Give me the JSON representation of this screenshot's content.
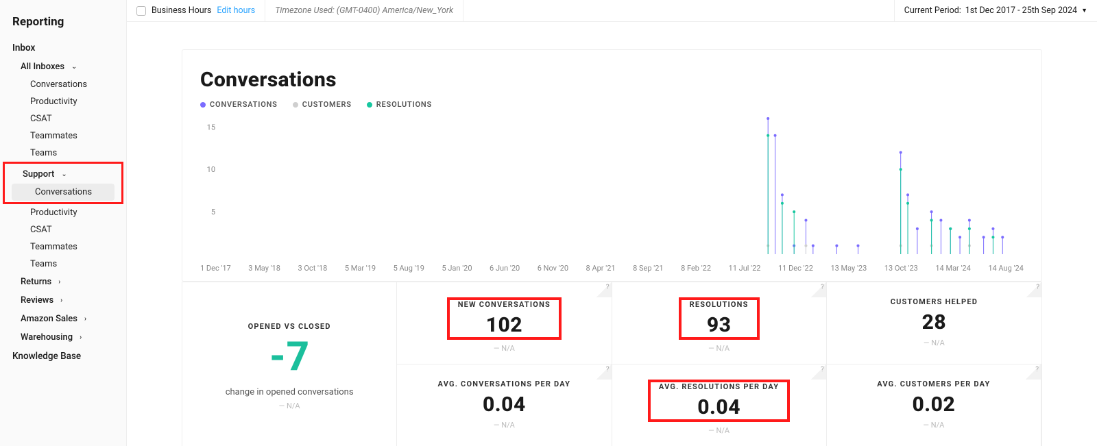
{
  "sidebar": {
    "title": "Reporting",
    "inbox": "Inbox",
    "allInboxes": "All Inboxes",
    "items1": [
      "Conversations",
      "Productivity",
      "CSAT",
      "Teammates",
      "Teams"
    ],
    "support": "Support",
    "items2": [
      "Conversations",
      "Productivity",
      "CSAT",
      "Teammates",
      "Teams"
    ],
    "others": [
      "Returns",
      "Reviews",
      "Amazon Sales",
      "Warehousing"
    ],
    "kb": "Knowledge Base"
  },
  "topbar": {
    "bh": "Business Hours",
    "edit": "Edit hours",
    "tz": "Timezone Used: (GMT-0400) America/New_York",
    "periodLabel": "Current Period:",
    "periodValue": "1st Dec 2017 - 25th Sep 2024"
  },
  "chart": {
    "title": "Conversations",
    "legend": [
      {
        "name": "CONVERSATIONS",
        "color": "#7b6cff"
      },
      {
        "name": "CUSTOMERS",
        "color": "#cfcfcf"
      },
      {
        "name": "RESOLUTIONS",
        "color": "#17c7a0"
      }
    ],
    "yticks": [
      5,
      10,
      15
    ]
  },
  "chart_data": {
    "type": "line",
    "title": "Conversations",
    "xlabel": "",
    "ylabel": "",
    "ylim": [
      0,
      16
    ],
    "categories": [
      "1 Dec '17",
      "3 May '18",
      "3 Oct '18",
      "5 Mar '19",
      "5 Aug '19",
      "5 Jan '20",
      "6 Jun '20",
      "6 Nov '20",
      "8 Apr '21",
      "8 Sep '21",
      "8 Feb '22",
      "11 Jul '22",
      "11 Dec '22",
      "13 May '23",
      "13 Oct '23",
      "14 Mar '24",
      "14 Aug '24"
    ],
    "series": [
      {
        "name": "CONVERSATIONS",
        "color": "#7b6cff",
        "points": [
          {
            "x": 11.55,
            "y": 16
          },
          {
            "x": 11.7,
            "y": 14
          },
          {
            "x": 11.85,
            "y": 7
          },
          {
            "x": 12.35,
            "y": 4
          },
          {
            "x": 12.1,
            "y": 1
          },
          {
            "x": 12.5,
            "y": 1
          },
          {
            "x": 13.0,
            "y": 1
          },
          {
            "x": 13.45,
            "y": 1
          },
          {
            "x": 14.35,
            "y": 12
          },
          {
            "x": 14.5,
            "y": 7
          },
          {
            "x": 14.7,
            "y": 3
          },
          {
            "x": 15.0,
            "y": 5
          },
          {
            "x": 15.2,
            "y": 4
          },
          {
            "x": 15.4,
            "y": 3
          },
          {
            "x": 15.6,
            "y": 2
          },
          {
            "x": 15.8,
            "y": 4
          },
          {
            "x": 16.1,
            "y": 2
          },
          {
            "x": 16.3,
            "y": 3
          },
          {
            "x": 16.5,
            "y": 2
          }
        ]
      },
      {
        "name": "CUSTOMERS",
        "color": "#cfcfcf",
        "points": [
          {
            "x": 11.55,
            "y": 1
          },
          {
            "x": 12.35,
            "y": 1
          },
          {
            "x": 14.35,
            "y": 1
          },
          {
            "x": 15.0,
            "y": 1
          },
          {
            "x": 15.8,
            "y": 1
          }
        ]
      },
      {
        "name": "RESOLUTIONS",
        "color": "#17c7a0",
        "points": [
          {
            "x": 11.55,
            "y": 14
          },
          {
            "x": 11.85,
            "y": 6
          },
          {
            "x": 12.1,
            "y": 5
          },
          {
            "x": 14.35,
            "y": 10
          },
          {
            "x": 14.5,
            "y": 6
          },
          {
            "x": 15.0,
            "y": 4
          },
          {
            "x": 15.4,
            "y": 3
          },
          {
            "x": 15.8,
            "y": 3
          },
          {
            "x": 16.3,
            "y": 2
          }
        ]
      }
    ]
  },
  "xlabels": [
    "1 Dec '17",
    "3 May '18",
    "3 Oct '18",
    "5 Mar '19",
    "5 Aug '19",
    "5 Jan '20",
    "6 Jun '20",
    "6 Nov '20",
    "8 Apr '21",
    "8 Sep '21",
    "8 Feb '22",
    "11 Jul '22",
    "11 Dec '22",
    "13 May '23",
    "13 Oct '23",
    "14 Mar '24",
    "14 Aug '24"
  ],
  "metrics": {
    "big": {
      "label": "OPENED VS CLOSED",
      "value": "-7",
      "sub": "change in opened conversations",
      "na": "N/A"
    },
    "r1": [
      {
        "label": "NEW CONVERSATIONS",
        "value": "102",
        "na": "N/A",
        "anno": true
      },
      {
        "label": "RESOLUTIONS",
        "value": "93",
        "na": "N/A",
        "anno": true
      },
      {
        "label": "CUSTOMERS HELPED",
        "value": "28",
        "na": "N/A",
        "anno": false
      }
    ],
    "r2": [
      {
        "label": "AVG. CONVERSATIONS PER DAY",
        "value": "0.04",
        "na": "N/A",
        "anno": false
      },
      {
        "label": "AVG. RESOLUTIONS PER DAY",
        "value": "0.04",
        "na": "N/A",
        "anno": true
      },
      {
        "label": "AVG. CUSTOMERS PER DAY",
        "value": "0.02",
        "na": "N/A",
        "anno": false
      }
    ]
  }
}
